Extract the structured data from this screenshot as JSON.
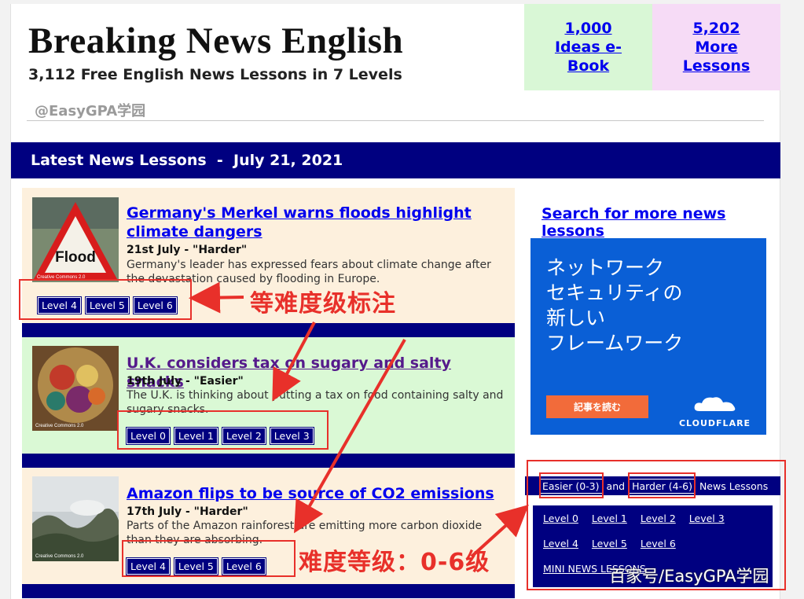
{
  "header": {
    "title": "Breaking News English",
    "subtitle": "3,112 Free English News Lessons in 7 Levels",
    "watermark": "@EasyGPA学园",
    "promo_1": "1,000 Ideas e-Book",
    "promo_2": "5,202 More Lessons"
  },
  "latest_bar": "Latest News Lessons  -  July 21, 2021",
  "lessons": [
    {
      "title": "Germany's Merkel warns floods highlight climate dangers",
      "date": "21st July - \"Harder\"",
      "desc": "Germany's leader has expressed fears about climate change after the devastation caused by flooding in Europe.",
      "levels": [
        "Level 4",
        "Level 5",
        "Level 6"
      ],
      "thumb_label": "Flood",
      "thumb_credit": "Creative Commons 2.0",
      "bg": "#fdf0dd"
    },
    {
      "title": "U.K. considers tax on sugary and salty snacks",
      "date": "19th July - \"Easier\"",
      "desc": "The U.K. is thinking about putting a tax on food containing salty and sugary snacks.",
      "levels": [
        "Level 0",
        "Level 1",
        "Level 2",
        "Level 3"
      ],
      "thumb_credit": "Creative Commons 2.0",
      "bg": "#daf9d5"
    },
    {
      "title": "Amazon flips to be source of CO2 emissions",
      "date": "17th July - \"Harder\"",
      "desc": "Parts of the Amazon rainforest are emitting more carbon dioxide than they are absorbing.",
      "levels": [
        "Level 4",
        "Level 5",
        "Level 6"
      ],
      "thumb_credit": "Creative Commons 2.0",
      "bg": "#fdf0dd"
    }
  ],
  "sidebar": {
    "search_link": "Search for more news lessons",
    "ad_text": "ネットワーク\nセキュリティの\n新しい\nフレームワーク",
    "ad_button": "記事を読む",
    "ad_brand": "CLOUDFLARE",
    "levels_head": {
      "easier": "Easier (0-3)",
      "and": "and",
      "harder": "Harder (4-6)",
      "suffix": "News Lessons"
    },
    "level_links": [
      [
        "Level 0",
        "Level 1",
        "Level 2",
        "Level 3"
      ],
      [
        "Level 4",
        "Level 5",
        "Level 6"
      ],
      [
        "MINI NEWS LESSONS"
      ]
    ]
  },
  "annotations": {
    "label_1": "等难度级标注",
    "label_2": "难度等级：0-6级",
    "color": "#e8302a"
  },
  "bottom_watermark": "百家号/EasyGPA学园"
}
